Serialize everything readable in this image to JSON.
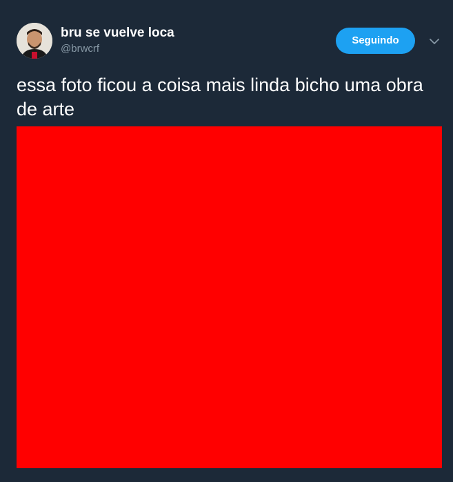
{
  "tweet": {
    "display_name": "bru se vuelve loca",
    "handle": "@brwcrf",
    "follow_button_label": "Seguindo",
    "text": "essa foto ficou a coisa mais linda bicho uma obra de arte",
    "media_color": "#ff0000"
  },
  "colors": {
    "background": "#1c2938",
    "accent": "#1da1f2",
    "secondary_text": "#8899a6"
  },
  "icons": {
    "caret": "chevron-down-icon",
    "avatar": "profile-photo"
  }
}
